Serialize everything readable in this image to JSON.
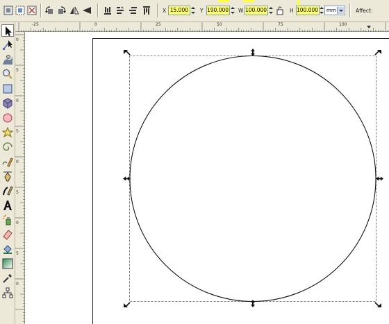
{
  "toolbar": {
    "x": {
      "label": "X",
      "value": "15.000"
    },
    "y": {
      "label": "Y",
      "value": "190.000"
    },
    "w": {
      "label": "W",
      "value": "100.000"
    },
    "h": {
      "label": "H",
      "value": "100.000"
    },
    "unit": "mm",
    "affect_label": "Affect:",
    "highlight_color": "#ffff33",
    "icons": [
      "select-all-icon",
      "select-all-layers-icon",
      "deselect-icon",
      "rotate-ccw-icon",
      "rotate-cw-icon",
      "flip-horizontal-icon",
      "flip-vertical-icon",
      "raise-to-top-icon",
      "raise-icon",
      "lower-icon",
      "lower-to-bottom-icon",
      "lock-proportions-icon"
    ]
  },
  "ruler": {
    "h_labels": [
      "-25",
      "0",
      "25",
      "50",
      "75",
      "100"
    ],
    "v_labels": [
      "0",
      "5",
      "0",
      "5",
      "0",
      "5",
      "0",
      "5",
      "0"
    ]
  },
  "toolbox": {
    "tools": [
      "selector-tool-icon",
      "node-tool-icon",
      "tweak-tool-icon",
      "zoom-tool-icon",
      "rectangle-tool-icon",
      "box-3d-tool-icon",
      "ellipse-tool-icon",
      "star-tool-icon",
      "spiral-tool-icon",
      "pencil-tool-icon",
      "pen-tool-icon",
      "calligraphy-tool-icon",
      "text-tool-icon",
      "spray-tool-icon",
      "eraser-tool-icon",
      "paint-bucket-tool-icon",
      "gradient-tool-icon",
      "dropper-tool-icon",
      "connector-tool-icon"
    ]
  }
}
